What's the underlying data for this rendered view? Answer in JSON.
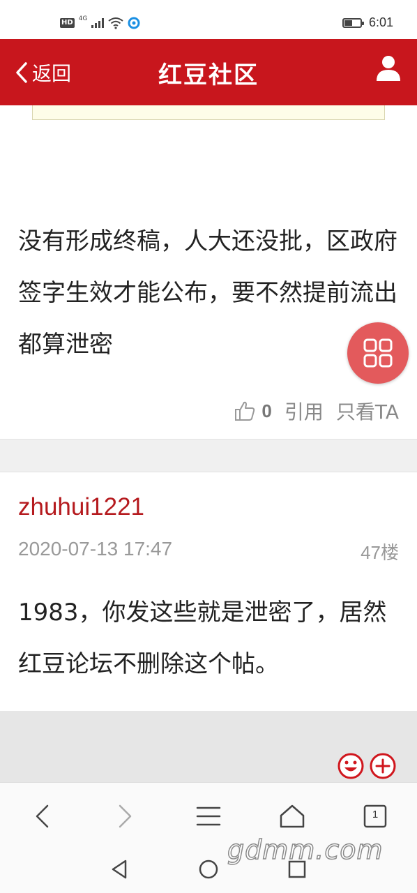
{
  "status_bar": {
    "network": "HD",
    "signal_type": "4G",
    "time": "6:01",
    "battery_level": 0.45
  },
  "header": {
    "back_label": "返回",
    "title": "红豆社区",
    "user_icon": "user-icon",
    "background": "#c8161d"
  },
  "posts": [
    {
      "text": "没有形成终稿，人大还没批，区政府签字生效才能公布，要不然提前流出都算泄密",
      "likes": "0",
      "quote_label": "引用",
      "only_author_label": "只看TA"
    },
    {
      "username": "zhuhui1221",
      "date": "2020-07-13 17:47",
      "floor": "47楼",
      "text": "1983，你发这些就是泄密了，居然红豆论坛不删除这个帖。"
    }
  ],
  "toolbar": {
    "tab_count": "1",
    "icons": [
      "back-icon",
      "forward-icon",
      "menu-icon",
      "home-icon",
      "tabs-icon"
    ]
  },
  "watermark": "gdmm.com",
  "accent_color": "#b51a1e"
}
